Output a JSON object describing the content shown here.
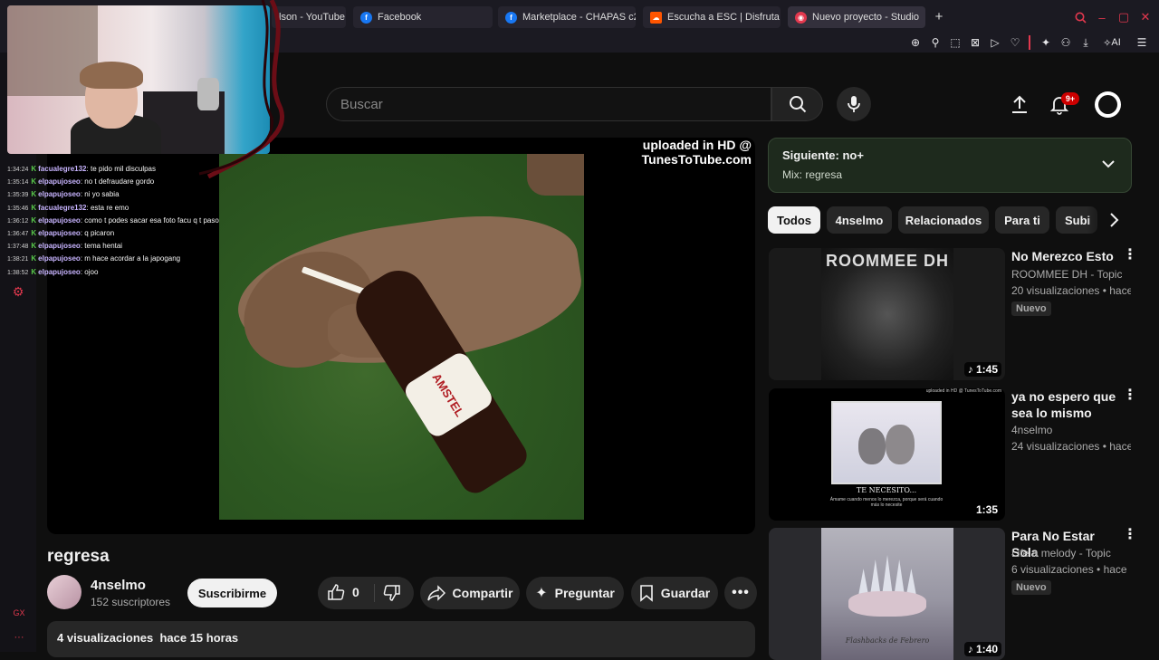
{
  "browser": {
    "tabs": [
      {
        "label": "lson - YouTube",
        "icon": "youtube-icon"
      },
      {
        "label": "Facebook",
        "icon": "facebook-icon"
      },
      {
        "label": "Marketplace - CHAPAS c2",
        "icon": "facebook-icon"
      },
      {
        "label": "Escucha a ESC | Disfruta",
        "icon": "soundcloud-icon"
      },
      {
        "label": "Nuevo proyecto - Studio",
        "icon": "studio-icon"
      }
    ],
    "ai_label": "AI",
    "gx_label": "GX"
  },
  "header": {
    "search_placeholder": "Buscar",
    "notifications_count": "9+"
  },
  "player": {
    "watermark": "uploaded in HD @ TunesToTube.com",
    "bottle_label": "AMSTEL"
  },
  "video": {
    "title": "regresa",
    "channel": "4nselmo",
    "subscribers": "152 suscriptores",
    "subscribe_label": "Suscribirme",
    "likes": "0",
    "share_label": "Compartir",
    "ask_label": "Preguntar",
    "save_label": "Guardar",
    "stats": "4 visualizaciones  hace 15 horas"
  },
  "upnext": {
    "title": "Siguiente: no+",
    "subtitle": "Mix: regresa"
  },
  "chips": [
    "Todos",
    "4nselmo",
    "Relacionados",
    "Para ti",
    "Subi"
  ],
  "recommendations": [
    {
      "title": "No Merezco Esto",
      "channel": "ROOMMEE DH - Topic",
      "views": "20 visualizaciones • hace…",
      "badge": "Nuevo",
      "duration": "♪ 1:45",
      "thumb_text": "ROOMMEE DH"
    },
    {
      "title": "ya no espero que sea lo mismo",
      "channel": "4nselmo",
      "views": "24 visualizaciones • hace…",
      "badge": "",
      "duration": "1:35",
      "thumb_text": "TE NECESITO...",
      "thumb_sub": "Ámame cuando menos lo merezca, porque será cuando más lo necesite",
      "thumb_wm": "uploaded in HD @ TunesToTube.com"
    },
    {
      "title": "Para No Estar Sola",
      "channel": "Life a melody - Topic",
      "views": "6 visualizaciones • hace …",
      "badge": "Nuevo",
      "duration": "♪ 1:40",
      "thumb_text": "Flashbacks de Febrero"
    }
  ],
  "chat": [
    {
      "time": "1:34:24",
      "user": "facualegre132",
      "msg": "te pido mil disculpas"
    },
    {
      "time": "1:35:14",
      "user": "elpapujoseo",
      "msg": "no t defraudare gordo"
    },
    {
      "time": "1:35:39",
      "user": "elpapujoseo",
      "msg": "ni yo sabia"
    },
    {
      "time": "1:35:46",
      "user": "facualegre132",
      "msg": "esta re emo"
    },
    {
      "time": "1:36:12",
      "user": "elpapujoseo",
      "msg": "como t podes sacar esa foto facu q t paso"
    },
    {
      "time": "1:36:47",
      "user": "elpapujoseo",
      "msg": "q picaron"
    },
    {
      "time": "1:37:48",
      "user": "elpapujoseo",
      "msg": "tema hentai"
    },
    {
      "time": "1:38:21",
      "user": "elpapujoseo",
      "msg": "m hace acordar a la japogang"
    },
    {
      "time": "1:38:52",
      "user": "elpapujoseo",
      "msg": "ojoo"
    }
  ],
  "colors": {
    "accent_red": "#e2384e",
    "subscribe_bg": "#f1f1f1",
    "upnext_bg": "#1e2a1d",
    "bell_badge": "#cc0000"
  }
}
